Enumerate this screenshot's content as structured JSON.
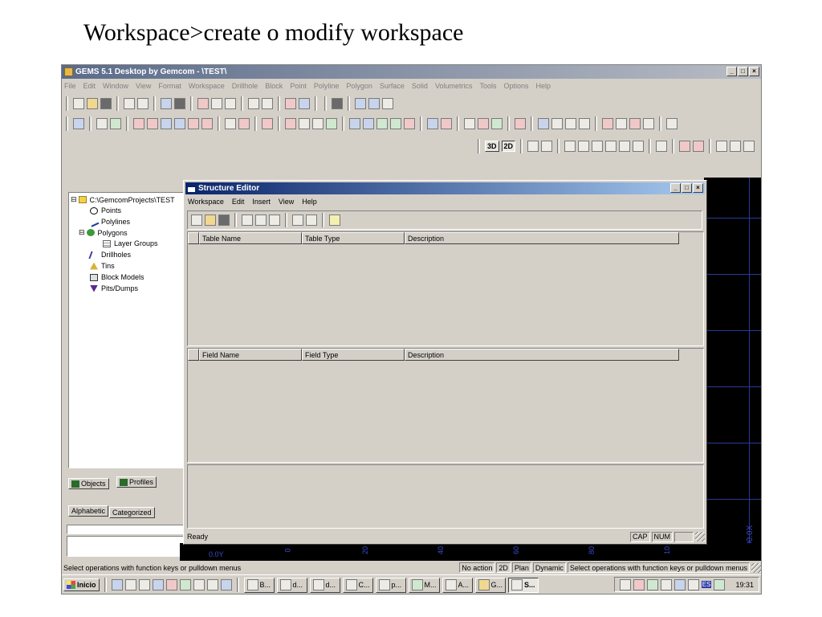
{
  "slide_title": "Workspace>create o modify workspace",
  "app": {
    "title": "GEMS 5.1 Desktop by Gemcom - \\TEST\\",
    "window_buttons": [
      "_",
      "□",
      "×"
    ],
    "menu": [
      "File",
      "Edit",
      "Window",
      "View",
      "Format",
      "Workspace",
      "Drillhole",
      "Block",
      "Point",
      "Polyline",
      "Polygon",
      "Surface",
      "Solid",
      "Volumetrics",
      "Tools",
      "Options",
      "Help"
    ],
    "view_buttons": {
      "three_d": "3D",
      "two_d": "2D"
    }
  },
  "tree": {
    "root": "C:\\GemcomProjects\\TEST",
    "items": [
      "Points",
      "Polylines",
      "Polygons",
      "Layer Groups",
      "Drillholes",
      "Tins",
      "Block Models",
      "Pits/Dumps"
    ],
    "expanders": [
      "⊟",
      "⊟"
    ]
  },
  "left_tabs": {
    "objects": "Objects",
    "profiles": "Profiles",
    "alphabetic": "Alphabetic",
    "categorized": "Categorized"
  },
  "structure_editor": {
    "title": "Structure Editor",
    "menu": [
      "Workspace",
      "Edit",
      "Insert",
      "View",
      "Help"
    ],
    "table_headers": [
      "Table Name",
      "Table Type",
      "Description"
    ],
    "field_headers": [
      "Field Name",
      "Field Type",
      "Description"
    ],
    "status": {
      "ready": "Ready",
      "cap": "CAP",
      "num": "NUM"
    }
  },
  "graphics": {
    "side_label": "1200.0X",
    "bottom_text": "0.0Y",
    "bottom_ticks": [
      "0",
      "20",
      "40",
      "60",
      "80",
      "10"
    ]
  },
  "statusbar": {
    "message": "Select operations with function keys or pulldown menus",
    "cells": [
      "No action",
      "2D",
      "Plan",
      "Dynamic",
      "Select operations with function keys or pulldown menus"
    ]
  },
  "taskbar": {
    "start": "Inicio",
    "tasks": [
      "B...",
      "d...",
      "d...",
      "C...",
      "p...",
      "M...",
      "A...",
      "G...",
      "S..."
    ],
    "tray_lang": "ES",
    "clock": "19:31"
  }
}
